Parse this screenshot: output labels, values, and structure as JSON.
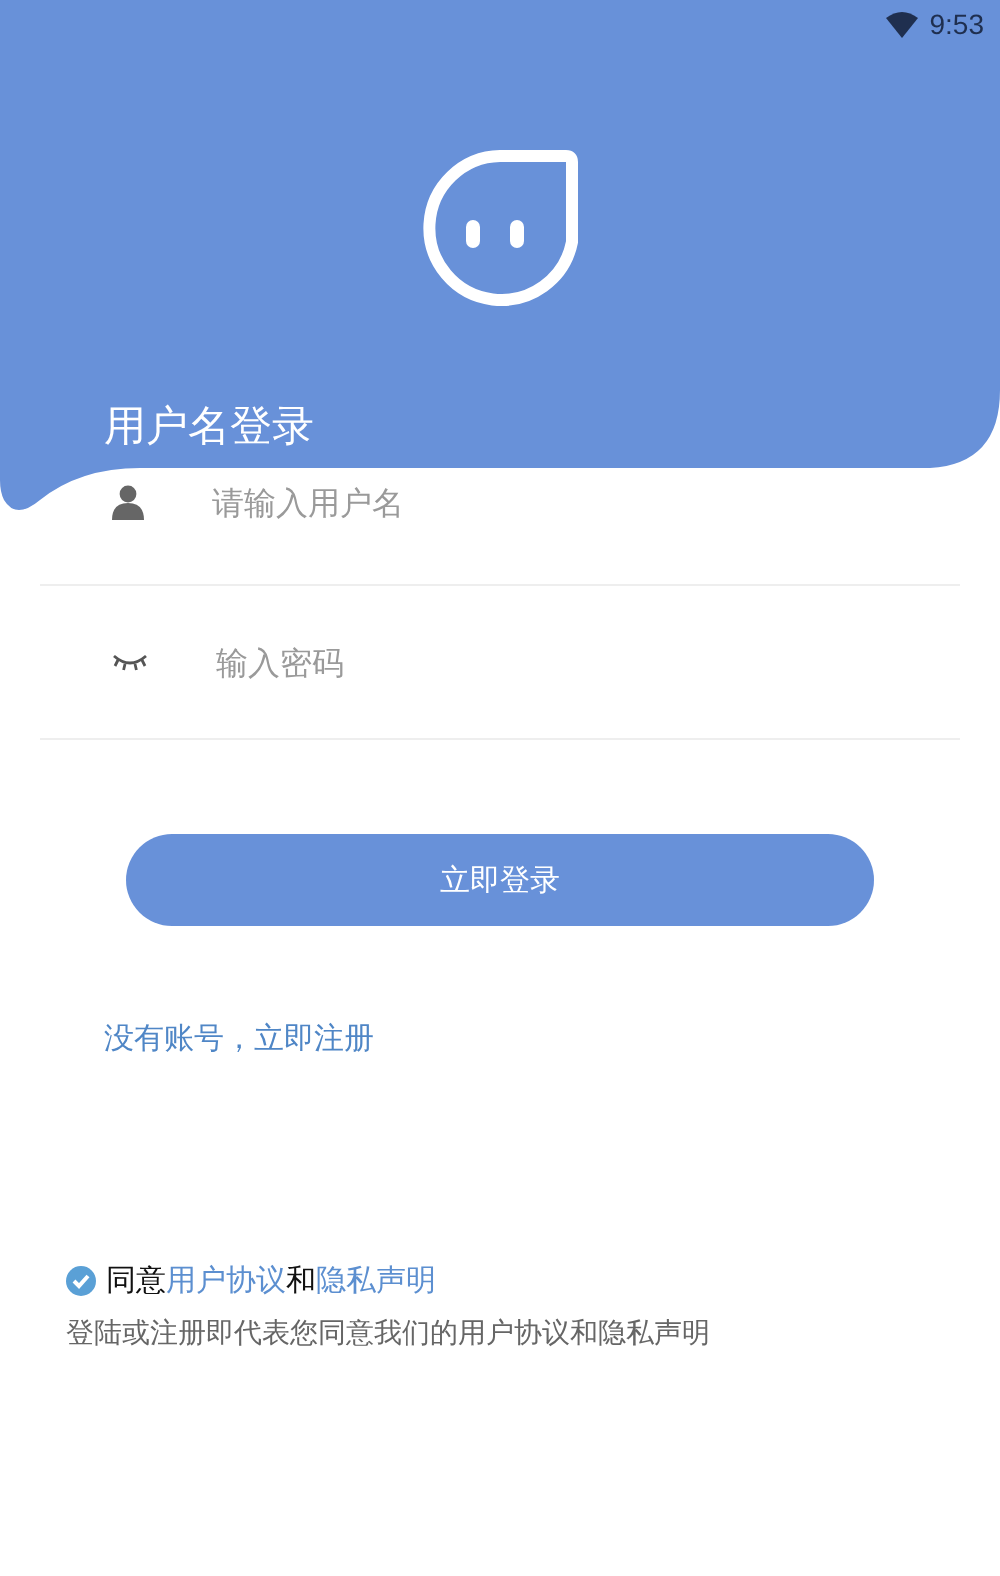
{
  "status_bar": {
    "time": "9:53"
  },
  "header": {
    "title": "用户名登录"
  },
  "fields": [
    {
      "kind": "user",
      "placeholder": "请输入用户名"
    },
    {
      "kind": "password",
      "placeholder": "输入密码"
    }
  ],
  "login_button": "立即登录",
  "register_link": "没有账号，立即注册",
  "agreement": {
    "checked": true,
    "prefix": "同意",
    "link_1": "用户协议",
    "joiner": "和",
    "link_2": "隐私声明",
    "notice": "登陆或注册即代表您同意我们的用户协议和隐私声明"
  }
}
